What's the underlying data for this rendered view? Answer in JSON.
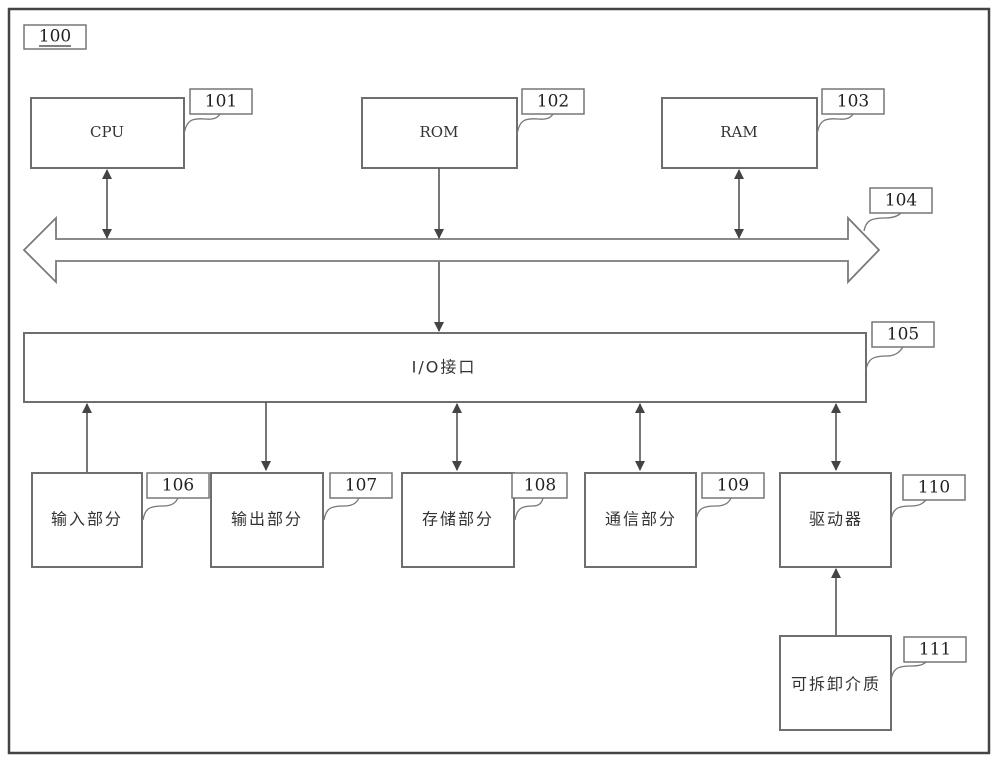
{
  "figure": {
    "ref": "100",
    "components": {
      "cpu": {
        "label": "CPU",
        "ref": "101"
      },
      "rom": {
        "label": "ROM",
        "ref": "102"
      },
      "ram": {
        "label": "RAM",
        "ref": "103"
      },
      "bus": {
        "label": "",
        "ref": "104"
      },
      "io": {
        "label": "I/O接口",
        "ref": "105"
      },
      "input": {
        "label": "输入部分",
        "ref": "106"
      },
      "output": {
        "label": "输出部分",
        "ref": "107"
      },
      "storage": {
        "label": "存储部分",
        "ref": "108"
      },
      "comm": {
        "label": "通信部分",
        "ref": "109"
      },
      "driver": {
        "label": "驱动器",
        "ref": "110"
      },
      "media": {
        "label": "可拆卸介质",
        "ref": "111"
      }
    },
    "connections": [
      {
        "from": "cpu",
        "to": "bus",
        "direction": "bidirectional"
      },
      {
        "from": "rom",
        "to": "bus",
        "direction": "one-way"
      },
      {
        "from": "ram",
        "to": "bus",
        "direction": "bidirectional"
      },
      {
        "from": "bus",
        "to": "io",
        "direction": "one-way"
      },
      {
        "from": "input",
        "to": "io",
        "direction": "one-way"
      },
      {
        "from": "io",
        "to": "output",
        "direction": "one-way"
      },
      {
        "from": "io",
        "to": "storage",
        "direction": "bidirectional"
      },
      {
        "from": "io",
        "to": "comm",
        "direction": "bidirectional"
      },
      {
        "from": "io",
        "to": "driver",
        "direction": "bidirectional"
      },
      {
        "from": "media",
        "to": "driver",
        "direction": "one-way"
      }
    ]
  }
}
